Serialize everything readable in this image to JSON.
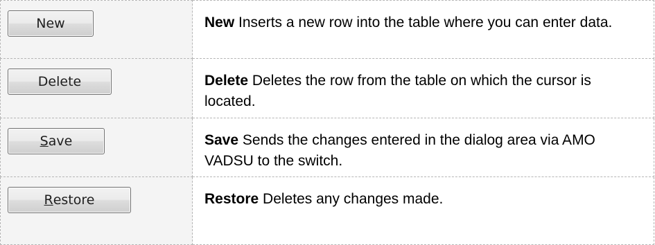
{
  "rows": [
    {
      "button": {
        "pre": "",
        "accel": "",
        "post": "New"
      },
      "title": "New",
      "description": "Inserts a new row into the table where you can enter data."
    },
    {
      "button": {
        "pre": "",
        "accel": "",
        "post": "Delete"
      },
      "title": "Delete",
      "description": "Deletes the row from the table on which the cursor is located."
    },
    {
      "button": {
        "pre": "",
        "accel": "S",
        "post": "ave"
      },
      "title": "Save",
      "description": "Sends the changes entered in the dialog area via AMO VADSU to the switch."
    },
    {
      "button": {
        "pre": "",
        "accel": "R",
        "post": "estore"
      },
      "title": "Restore",
      "description": "Deletes any changes made."
    }
  ]
}
